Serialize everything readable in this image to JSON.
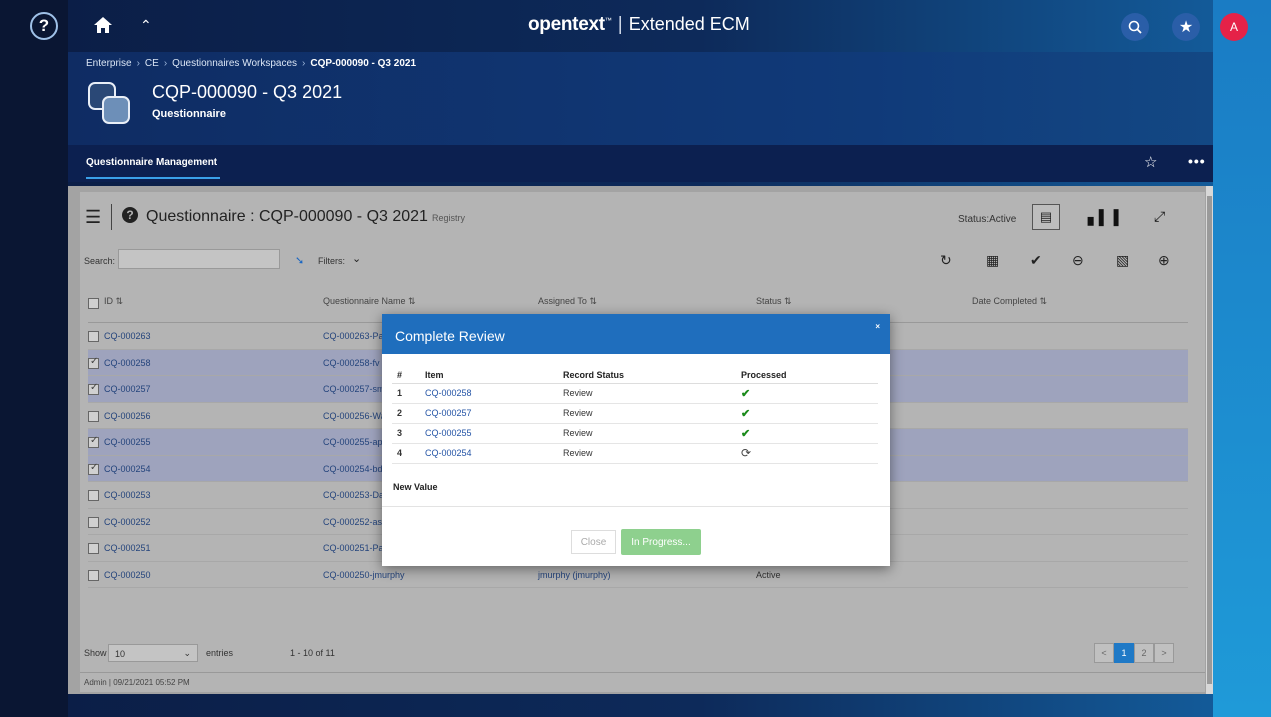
{
  "topbar": {
    "help_glyph": "?",
    "brand_name": "opentext",
    "brand_tm": "™",
    "product": "Extended ECM",
    "avatar_initial": "A"
  },
  "breadcrumb": {
    "items": [
      "Enterprise",
      "CE",
      "Questionnaires Workspaces"
    ],
    "current": "CQP-000090 - Q3 2021"
  },
  "workspace": {
    "title": "CQP-000090 - Q3 2021",
    "type": "Questionnaire"
  },
  "tabs": {
    "active": "Questionnaire Management"
  },
  "widget": {
    "title": "Questionnaire : CQP-000090 - Q3 2021",
    "subtitle": "Registry",
    "status": "Status:Active",
    "search_label": "Search:",
    "filters_label": "Filters:",
    "columns": [
      "ID",
      "Questionnaire Name",
      "Assigned To",
      "Status",
      "Date Completed"
    ],
    "rows": [
      {
        "id": "CQ-000263",
        "name": "CQ-000263-Pa",
        "assigned": "",
        "status": "",
        "selected": false
      },
      {
        "id": "CQ-000258",
        "name": "CQ-000258-fv",
        "assigned": "",
        "status": "",
        "selected": true
      },
      {
        "id": "CQ-000257",
        "name": "CQ-000257-sm",
        "assigned": "",
        "status": "",
        "selected": true
      },
      {
        "id": "CQ-000256",
        "name": "CQ-000256-Wa",
        "assigned": "",
        "status": "",
        "selected": false
      },
      {
        "id": "CQ-000255",
        "name": "CQ-000255-ap",
        "assigned": "",
        "status": "",
        "selected": true
      },
      {
        "id": "CQ-000254",
        "name": "CQ-000254-bd",
        "assigned": "",
        "status": "",
        "selected": true
      },
      {
        "id": "CQ-000253",
        "name": "CQ-000253-Da",
        "assigned": "",
        "status": "",
        "selected": false
      },
      {
        "id": "CQ-000252",
        "name": "CQ-000252-as",
        "assigned": "",
        "status": "",
        "selected": false
      },
      {
        "id": "CQ-000251",
        "name": "CQ-000251-Pa",
        "assigned": "",
        "status": "",
        "selected": false
      },
      {
        "id": "CQ-000250",
        "name": "CQ-000250-jmurphy",
        "assigned": "jmurphy (jmurphy)",
        "status": "Active",
        "selected": false
      }
    ],
    "show_label": "Show",
    "show_value": "10",
    "entries_label": "entries",
    "range": "1 - 10 of 11",
    "pages": [
      "<",
      "1",
      "2",
      ">"
    ],
    "active_page": "1",
    "footer": "Admin | 09/21/2021 05:52 PM"
  },
  "modal": {
    "title": "Complete Review",
    "close_glyph": "×",
    "columns": [
      "#",
      "Item",
      "Record Status",
      "Processed"
    ],
    "rows": [
      {
        "num": "1",
        "item": "CQ-000258",
        "status": "Review",
        "processed": "done"
      },
      {
        "num": "2",
        "item": "CQ-000257",
        "status": "Review",
        "processed": "done"
      },
      {
        "num": "3",
        "item": "CQ-000255",
        "status": "Review",
        "processed": "done"
      },
      {
        "num": "4",
        "item": "CQ-000254",
        "status": "Review",
        "processed": "in-progress"
      }
    ],
    "new_value_label": "New Value",
    "close_label": "Close",
    "progress_label": "In Progress..."
  },
  "colors": {
    "accent": "#1f6ebd",
    "avatar": "#e52248",
    "success": "#1a8a1a",
    "progress_button": "#8ed08e"
  }
}
